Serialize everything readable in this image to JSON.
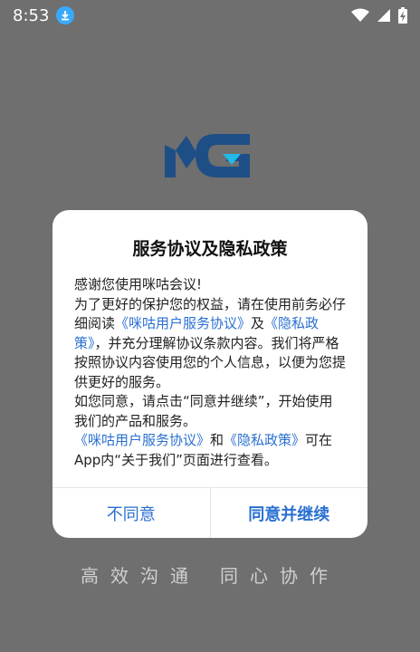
{
  "status_bar": {
    "time": "8:53"
  },
  "dialog": {
    "title": "服务协议及隐私政策",
    "greeting": "感谢您使用咪咕会议!",
    "p1_pre": "为了更好的保护您的权益，请在使用前务必仔细阅读",
    "link_service": "《咪咕用户服务协议》",
    "p1_and": "及",
    "link_privacy": "《隐私政策》",
    "p1_post": "，并充分理解协议条款内容。我们将严格按照协议内容使用您的个人信息，以便为您提供更好的服务。",
    "p2": "如您同意，请点击“同意并继续”，开始使用我们的产品和服务。",
    "p3_and": "和",
    "p3_post": "可在App内“关于我们”页面进行查看。",
    "disagree_label": "不同意",
    "agree_label": "同意并继续"
  },
  "slogan": {
    "left": "高效沟通",
    "right": "同心协作"
  },
  "colors": {
    "accent": "#2a70d1",
    "logo_dark": "#1d4f86",
    "logo_light": "#21b9e6"
  }
}
